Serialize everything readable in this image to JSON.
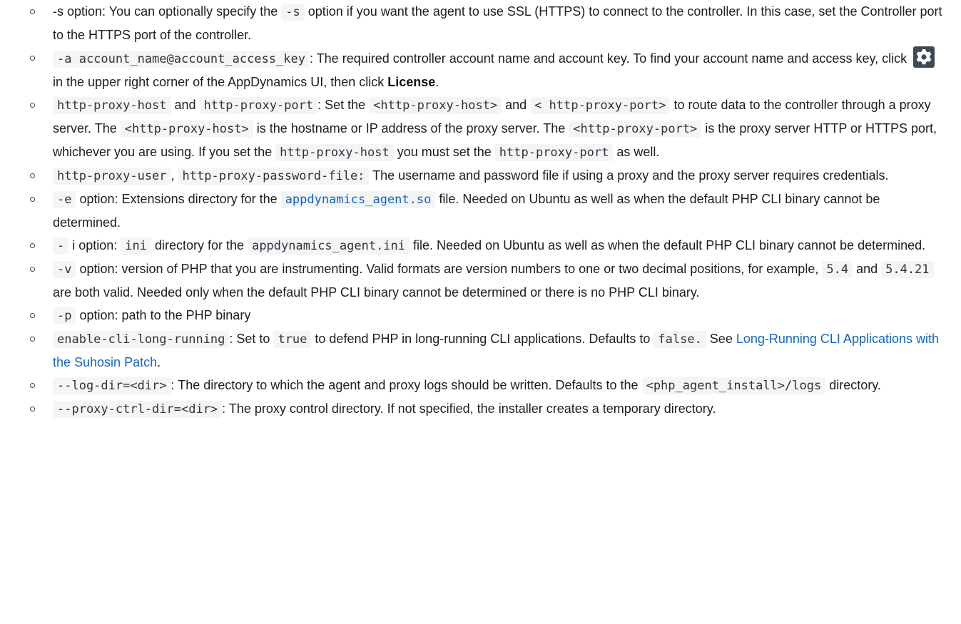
{
  "items": [
    {
      "parts": [
        {
          "t": "text",
          "v": "-s option: You can optionally specify the "
        },
        {
          "t": "code",
          "v": "-s"
        },
        {
          "t": "text",
          "v": " option if you want the agent to use SSL (HTTPS) to connect to the controller. In this case, set the Controller port to the HTTPS port of the controller."
        }
      ]
    },
    {
      "parts": [
        {
          "t": "code",
          "v": "-a account_name@account_access_key"
        },
        {
          "t": "text",
          "v": ": The required controller account name and account key. To find your account name and access key, click "
        },
        {
          "t": "icon",
          "v": "gear-icon"
        },
        {
          "t": "text",
          "v": " in the upper right corner of the AppDynamics UI, then click "
        },
        {
          "t": "bold",
          "v": "License"
        },
        {
          "t": "text",
          "v": "."
        }
      ]
    },
    {
      "parts": [
        {
          "t": "code",
          "v": "http-proxy-host"
        },
        {
          "t": "text",
          "v": " and "
        },
        {
          "t": "code",
          "v": "http-proxy-port"
        },
        {
          "t": "text",
          "v": ": Set the "
        },
        {
          "t": "code",
          "v": "<http-proxy-host>"
        },
        {
          "t": "text",
          "v": " and "
        },
        {
          "t": "code",
          "v": "< http-proxy-port>"
        },
        {
          "t": "text",
          "v": " to route data to the controller through a proxy server. The "
        },
        {
          "t": "code",
          "v": "<http-proxy-host>"
        },
        {
          "t": "text",
          "v": " is the hostname or IP address of the proxy server. The "
        },
        {
          "t": "code",
          "v": "<http-proxy-port>"
        },
        {
          "t": "text",
          "v": " is the proxy server HTTP or HTTPS port, whichever you are using. If you set the "
        },
        {
          "t": "code",
          "v": "http-proxy-host"
        },
        {
          "t": "text",
          "v": " you must set the "
        },
        {
          "t": "code",
          "v": "http-proxy-port"
        },
        {
          "t": "text",
          "v": " as well."
        }
      ]
    },
    {
      "parts": [
        {
          "t": "code",
          "v": "http-proxy-user"
        },
        {
          "t": "text",
          "v": ", "
        },
        {
          "t": "code",
          "v": "http-proxy-password-file:"
        },
        {
          "t": "text",
          "v": " The username and password file if using a proxy and the proxy server requires credentials."
        }
      ]
    },
    {
      "parts": [
        {
          "t": "code",
          "v": "-e"
        },
        {
          "t": "text",
          "v": " option: Extensions directory for the "
        },
        {
          "t": "codeblue",
          "v": "appdynamics_agent.so"
        },
        {
          "t": "text",
          "v": " file. Needed on Ubuntu as well as when the default PHP CLI binary cannot be determined."
        }
      ]
    },
    {
      "parts": [
        {
          "t": "code",
          "v": "-"
        },
        {
          "t": "text",
          "v": " i option: "
        },
        {
          "t": "code",
          "v": "ini"
        },
        {
          "t": "text",
          "v": " directory for the "
        },
        {
          "t": "code",
          "v": "appdynamics_agent.ini"
        },
        {
          "t": "text",
          "v": " file. Needed on Ubuntu as well as when the default PHP CLI binary cannot be determined."
        }
      ]
    },
    {
      "parts": [
        {
          "t": "code",
          "v": "-v"
        },
        {
          "t": "text",
          "v": " option: version of PHP that you are instrumenting. Valid formats are version numbers to one or two decimal positions, for example, "
        },
        {
          "t": "code",
          "v": "5.4"
        },
        {
          "t": "text",
          "v": " and "
        },
        {
          "t": "code",
          "v": "5.4.21"
        },
        {
          "t": "text",
          "v": " are both valid. Needed only when the default PHP CLI binary cannot be determined or there is no PHP CLI binary."
        }
      ]
    },
    {
      "parts": [
        {
          "t": "code",
          "v": "-p"
        },
        {
          "t": "text",
          "v": " option: path to the PHP binary"
        }
      ]
    },
    {
      "parts": [
        {
          "t": "code",
          "v": "enable-cli-long-running"
        },
        {
          "t": "text",
          "v": ": Set to "
        },
        {
          "t": "code",
          "v": "true"
        },
        {
          "t": "text",
          "v": " to defend PHP in long-running CLI applications. Defaults to "
        },
        {
          "t": "code",
          "v": "false."
        },
        {
          "t": "text",
          "v": " See "
        },
        {
          "t": "link",
          "v": "Long-Running CLI Applications with the Suhosin Patch"
        },
        {
          "t": "text",
          "v": "."
        }
      ]
    },
    {
      "parts": [
        {
          "t": "code",
          "v": "--log-dir=<dir>"
        },
        {
          "t": "text",
          "v": ": The directory to which the agent and proxy logs should be written. Defaults to the "
        },
        {
          "t": "code",
          "v": "<php_agent_install>/logs"
        },
        {
          "t": "text",
          "v": " directory."
        }
      ]
    },
    {
      "parts": [
        {
          "t": "code",
          "v": "--proxy-ctrl-dir=<dir>"
        },
        {
          "t": "text",
          "v": ": The proxy control directory. If not specified, the installer creates a temporary directory."
        }
      ]
    }
  ]
}
